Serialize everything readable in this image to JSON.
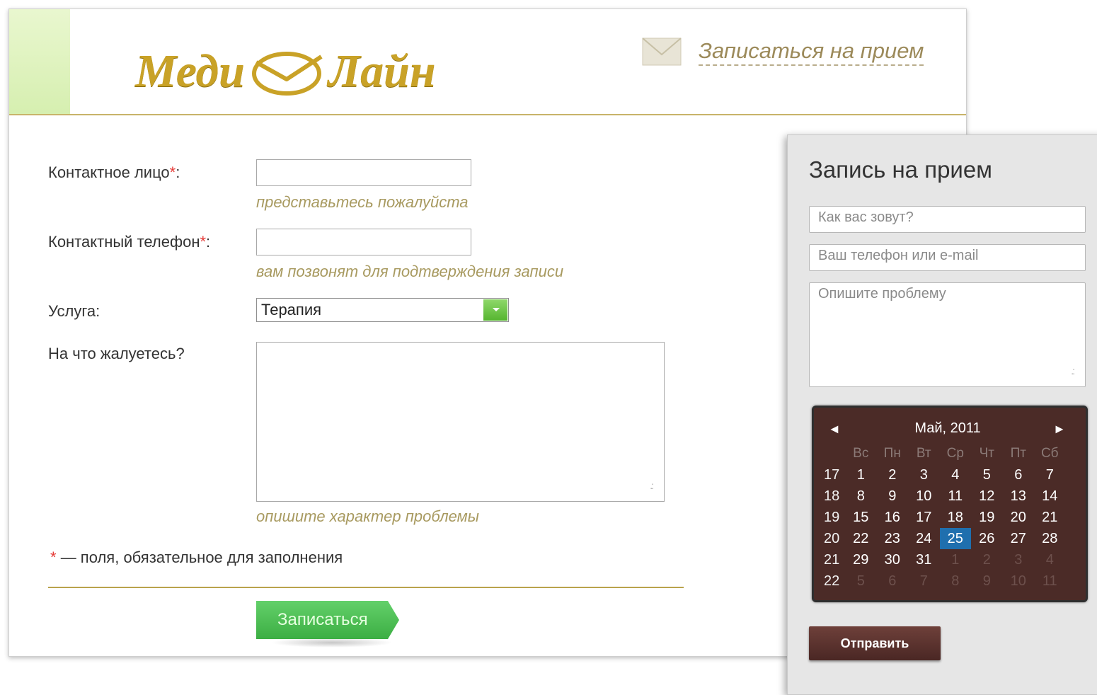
{
  "header": {
    "logo_left": "Меди",
    "logo_right": "Лайн",
    "link": "Записаться на прием",
    "accent": "#c9a227"
  },
  "form": {
    "contact_label": "Контактное лицо",
    "contact_hint": "представьтесь пожалуйста",
    "phone_label": "Контактный телефон",
    "phone_hint": "вам позвонят для подтверждения записи",
    "service_label": "Услуга:",
    "service_value": "Терапия",
    "complaint_label": "На что жалуетесь?",
    "complaint_hint": "опишите характер проблемы",
    "required_note": "— поля, обязательное для заполнения",
    "required_mark": "*",
    "colon": ":",
    "submit_label": "Записаться"
  },
  "panel": {
    "title": "Запись на прием",
    "name_placeholder": "Как вас зовут?",
    "contact_placeholder": "Ваш телефон или e-mail",
    "problem_placeholder": "Опишите проблему",
    "send_label": "Отправить"
  },
  "calendar": {
    "prev": "◄",
    "next": "►",
    "title": "Май, 2011",
    "day_names": [
      "Вс",
      "Пн",
      "Вт",
      "Ср",
      "Чт",
      "Пт",
      "Сб"
    ],
    "weeks": [
      {
        "week": "17",
        "days": [
          {
            "d": "1"
          },
          {
            "d": "2"
          },
          {
            "d": "3"
          },
          {
            "d": "4"
          },
          {
            "d": "5"
          },
          {
            "d": "6"
          },
          {
            "d": "7"
          }
        ]
      },
      {
        "week": "18",
        "days": [
          {
            "d": "8"
          },
          {
            "d": "9"
          },
          {
            "d": "10"
          },
          {
            "d": "11"
          },
          {
            "d": "12"
          },
          {
            "d": "13"
          },
          {
            "d": "14"
          }
        ]
      },
      {
        "week": "19",
        "days": [
          {
            "d": "15"
          },
          {
            "d": "16"
          },
          {
            "d": "17"
          },
          {
            "d": "18"
          },
          {
            "d": "19"
          },
          {
            "d": "20"
          },
          {
            "d": "21"
          }
        ]
      },
      {
        "week": "20",
        "days": [
          {
            "d": "22"
          },
          {
            "d": "23"
          },
          {
            "d": "24"
          },
          {
            "d": "25",
            "selected": true
          },
          {
            "d": "26"
          },
          {
            "d": "27"
          },
          {
            "d": "28"
          }
        ]
      },
      {
        "week": "21",
        "days": [
          {
            "d": "29"
          },
          {
            "d": "30"
          },
          {
            "d": "31"
          },
          {
            "d": "1",
            "muted": true
          },
          {
            "d": "2",
            "muted": true
          },
          {
            "d": "3",
            "muted": true
          },
          {
            "d": "4",
            "muted": true
          }
        ]
      },
      {
        "week": "22",
        "days": [
          {
            "d": "5",
            "muted": true
          },
          {
            "d": "6",
            "muted": true
          },
          {
            "d": "7",
            "muted": true
          },
          {
            "d": "8",
            "muted": true
          },
          {
            "d": "9",
            "muted": true
          },
          {
            "d": "10",
            "muted": true
          },
          {
            "d": "11",
            "muted": true
          }
        ]
      }
    ],
    "selected_color": "#1f6fae"
  }
}
